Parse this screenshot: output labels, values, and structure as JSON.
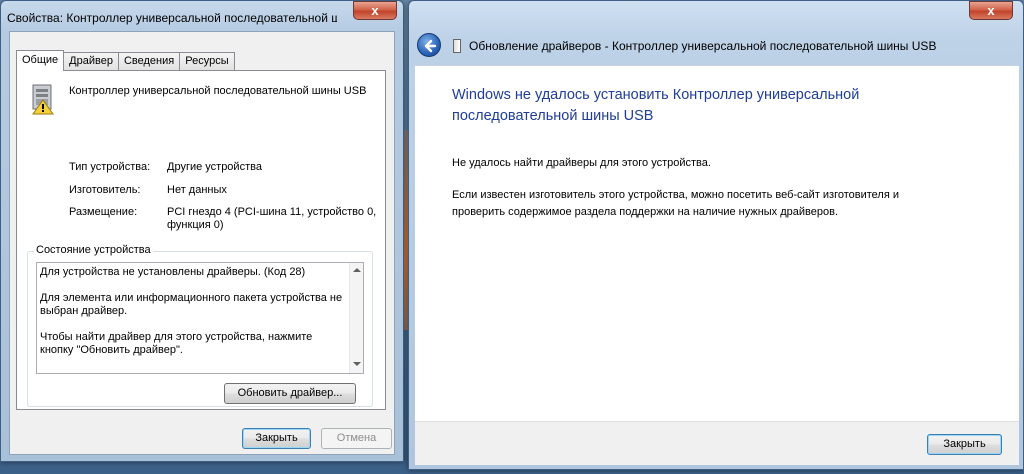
{
  "properties_window": {
    "title": "Свойства: Контроллер универсальной последовательной шины USB",
    "tabs": [
      "Общие",
      "Драйвер",
      "Сведения",
      "Ресурсы"
    ],
    "device_name": "Контроллер универсальной последовательной шины USB",
    "props": {
      "type_label": "Тип устройства:",
      "type_value": "Другие устройства",
      "maker_label": "Изготовитель:",
      "maker_value": "Нет данных",
      "location_label": "Размещение:",
      "location_value": "PCI гнездо 4 (PCI-шина 11, устройство 0, функция 0)"
    },
    "status_group": {
      "legend": "Состояние устройства",
      "line1": "Для устройства не установлены драйверы. (Код 28)",
      "line2": "Для элемента или информационного пакета устройства не выбран драйвер.",
      "line3": "Чтобы найти драйвер для этого устройства, нажмите кнопку \"Обновить драйвер\"."
    },
    "update_driver_button": "Обновить драйвер...",
    "close_button": "Закрыть",
    "cancel_button": "Отмена",
    "close_x": "x"
  },
  "update_window": {
    "title": "Обновление драйверов - Контроллер универсальной последовательной шины USB",
    "heading": "Windows не удалось установить Контроллер универсальной последовательной шины USB",
    "message1": "Не удалось найти драйверы для этого устройства.",
    "message2": "Если известен изготовитель этого устройства, можно посетить веб-сайт изготовителя и проверить содержимое раздела поддержки на наличие нужных драйверов.",
    "close_button": "Закрыть",
    "close_x": "x"
  }
}
